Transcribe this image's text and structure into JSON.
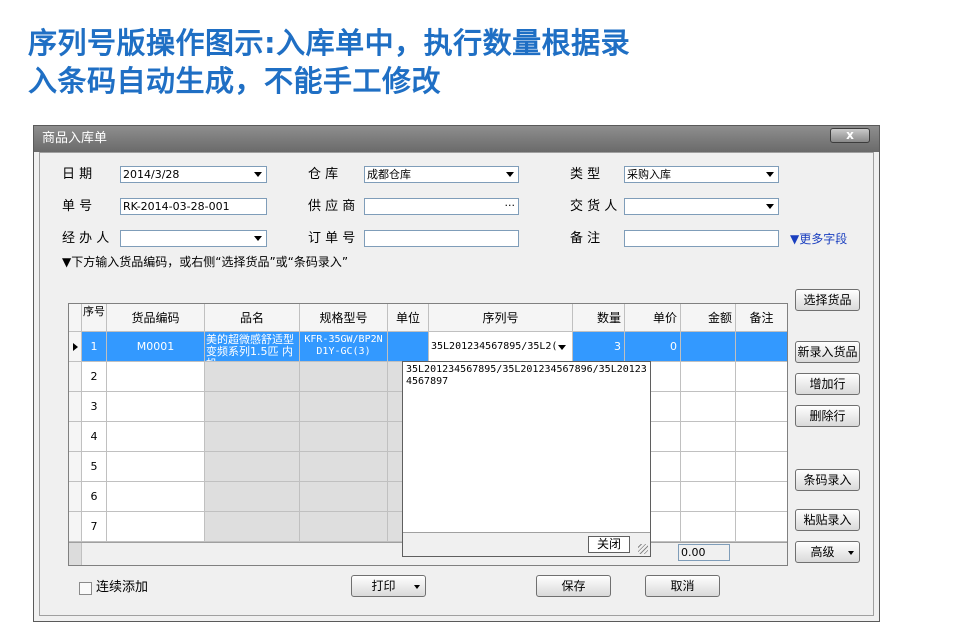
{
  "headline": {
    "line1": "序列号版操作图示:入库单中，执行数量根据录",
    "line2": "入条码自动生成，不能手工修改"
  },
  "window": {
    "title": "商品入库单",
    "close_label": "x"
  },
  "form": {
    "date_label": "日    期",
    "date_value": "2014/3/28",
    "warehouse_label": "仓    库",
    "warehouse_value": "成都仓库",
    "type_label": "类    型",
    "type_value": "采购入库",
    "number_label": "单    号",
    "number_value": "RK-2014-03-28-001",
    "supplier_label": "供 应 商",
    "supplier_value": "",
    "supplier_button": "···",
    "deliverer_label": "交 货 人",
    "deliverer_value": "",
    "handler_label": "经 办 人",
    "handler_value": "",
    "order_label": "订 单 号",
    "order_value": "",
    "remark_label": "备    注",
    "remark_value": "",
    "more_fields": "▼更多字段"
  },
  "hint": "▼下方输入货品编码，或右侧“选择货品”或“条码录入”",
  "grid": {
    "columns": [
      "序号",
      "货品编码",
      "品名",
      "规格型号",
      "单位",
      "序列号",
      "数量",
      "单价",
      "金额",
      "备注"
    ],
    "rows": [
      {
        "index": "1",
        "code": "M0001",
        "name": "美的超微感舒适型变频系列1.5匹 内机",
        "spec": "KFR-35GW/BP2N D1Y-GC(3)",
        "unit": "",
        "serial": "35L201234567895/35L2(",
        "qty": "3",
        "price": "0",
        "amount": "",
        "remark": ""
      },
      {
        "index": "2"
      },
      {
        "index": "3"
      },
      {
        "index": "4"
      },
      {
        "index": "5"
      },
      {
        "index": "6"
      },
      {
        "index": "7"
      }
    ],
    "total": "0.00"
  },
  "serial_popup": {
    "text": "35L201234567895/35L201234567896/35L201234567897",
    "close_label": "关闭"
  },
  "side_buttons": {
    "select_goods": "选择货品",
    "new_goods": "新录入货品",
    "add_row": "增加行",
    "delete_row": "删除行",
    "barcode_entry": "条码录入",
    "paste_entry": "粘贴录入",
    "advanced": "高级"
  },
  "footer": {
    "continuous_add": "连续添加",
    "print": "打印",
    "save": "保存",
    "cancel": "取消"
  }
}
